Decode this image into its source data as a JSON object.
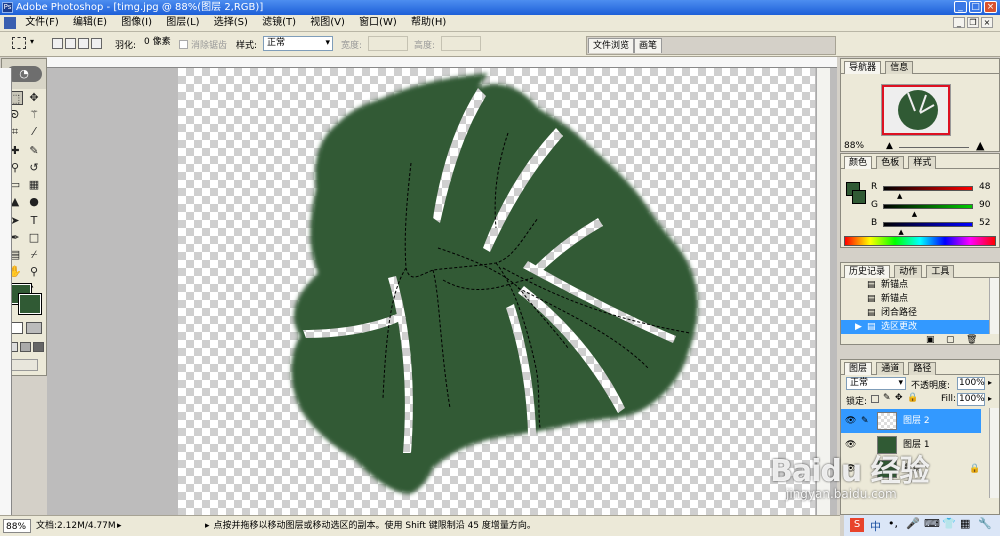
{
  "window": {
    "title": "Adobe Photoshop - [timg.jpg @ 88%(图层 2,RGB)]"
  },
  "menu": [
    "文件(F)",
    "编辑(E)",
    "图像(I)",
    "图层(L)",
    "选择(S)",
    "滤镜(T)",
    "视图(V)",
    "窗口(W)",
    "帮助(H)"
  ],
  "options": {
    "feather_label": "羽化:",
    "feather_value": "0 像素",
    "antialias_label": "消除锯齿",
    "style_label": "样式:",
    "style_value": "正常",
    "width_label": "宽度:",
    "height_label": "高度:",
    "tabs": [
      "文件浏览",
      "画笔"
    ]
  },
  "navigator": {
    "tabs": [
      "导航器",
      "信息"
    ],
    "zoom": "88%"
  },
  "color": {
    "tabs": [
      "颜色",
      "色板",
      "样式"
    ],
    "labels": [
      "R",
      "G",
      "B"
    ],
    "values": [
      "48",
      "90",
      "52"
    ],
    "r": 48,
    "g": 90,
    "b": 52,
    "swatch": "#305a34"
  },
  "history": {
    "tabs": [
      "历史记录",
      "动作",
      "工具"
    ],
    "items": [
      "新锚点",
      "新锚点",
      "闭合路径",
      "选区更改"
    ]
  },
  "layers": {
    "tabs": [
      "图层",
      "通道",
      "路径"
    ],
    "blend": "正常",
    "opacity_label": "不透明度:",
    "opacity": "100%",
    "lock_label": "锁定:",
    "fill_label": "Fill:",
    "fill": "100%",
    "items": [
      "图层 2",
      "图层 1",
      "背景"
    ]
  },
  "status": {
    "zoom": "88%",
    "doc": "文档:2.12M/4.77M",
    "hint": "点按并拖移以移动图层或移动选区的副本。使用 Shift 键限制沿 45 度增量方向。"
  },
  "watermark": {
    "logo": "Baidu 经验",
    "url": "jingyan.baidu.com"
  },
  "taskbar": {
    "ime": "中"
  },
  "colors": {
    "leaf": "#305a34",
    "title": "#1d5fd8",
    "selection": "#3399ff"
  }
}
